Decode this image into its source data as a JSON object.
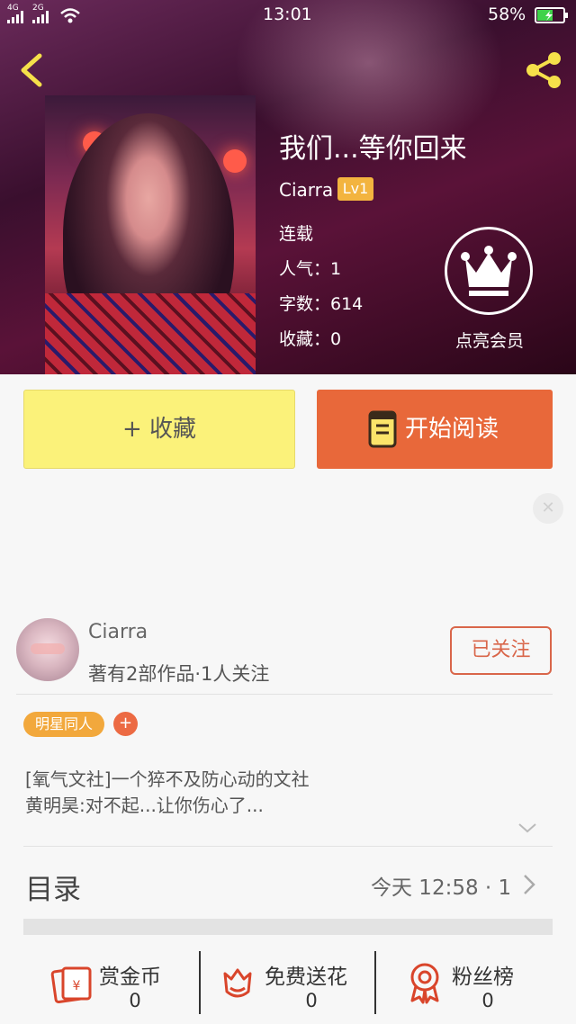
{
  "status_bar": {
    "signal_left": "4G",
    "signal_right": "2G",
    "time": "13:01",
    "battery": "58%"
  },
  "book": {
    "title": "我们...等你回来",
    "author": "Ciarra",
    "level": "Lv1",
    "status": "连载",
    "popularity": "人气：1",
    "word_count": "字数：614",
    "favorites": "收藏：0"
  },
  "vip": {
    "label": "点亮会员"
  },
  "actions": {
    "favorite_label": "+ 收藏",
    "read_label": "开始阅读"
  },
  "author_card": {
    "name": "Ciarra",
    "summary": "著有2部作品·1人关注",
    "follow_label": "已关注"
  },
  "tags": {
    "items": [
      "明星同人"
    ],
    "add_label": "+"
  },
  "description": {
    "line1": "[氧气文社]一个猝不及防心动的文社",
    "line2": "黄明昊:对不起...让你伤心了..."
  },
  "toc": {
    "title": "目录",
    "meta": "今天 12:58 · 1"
  },
  "bottom_bar": {
    "items": [
      {
        "label": "赏金币",
        "count": "0"
      },
      {
        "label": "免费送花",
        "count": "0"
      },
      {
        "label": "粉丝榜",
        "count": "0"
      }
    ]
  },
  "colors": {
    "accent_orange": "#e8683a",
    "favorite_yellow": "#fbf27a",
    "level_badge": "#f3b43f",
    "tag_orange": "#f2a83c"
  }
}
